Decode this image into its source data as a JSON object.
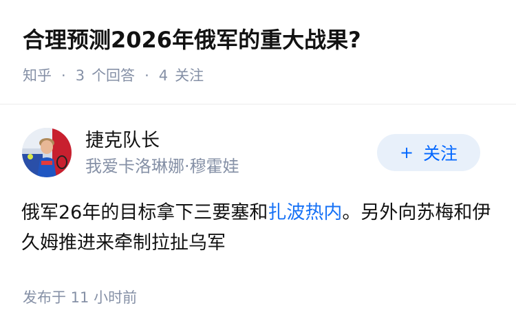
{
  "question": {
    "title": "合理预测2026年俄军的重大战果?",
    "source": "知乎",
    "answer_count": "3",
    "answer_label": "个回答",
    "follower_count": "4",
    "follower_label": "关注"
  },
  "answer": {
    "author": {
      "name": "捷克队长",
      "bio": "我爱卡洛琳娜·穆霍娃"
    },
    "follow_button": {
      "plus": "+",
      "label": "关注"
    },
    "content": {
      "before_link": "俄军26年的目标拿下三要塞和",
      "link": "扎波热内",
      "after_link": "。另外向苏梅和伊久姆推进来牵制拉扯乌军"
    },
    "published": "发布于 11 小时前"
  },
  "colors": {
    "link": "#1772f6",
    "meta_text": "#8590a6",
    "follow_bg": "#e8f0fa",
    "follow_text": "#0066ff"
  }
}
